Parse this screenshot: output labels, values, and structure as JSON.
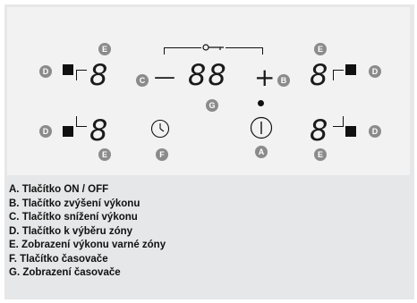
{
  "labels": {
    "A": "A",
    "B": "B",
    "C": "C",
    "D": "D",
    "E": "E",
    "F": "F",
    "G": "G"
  },
  "zone_display": "8",
  "timer_display": "88",
  "minus_symbol": "—",
  "plus_symbol": "+",
  "legend": [
    "A. Tlačítko ON / OFF",
    "B. Tlačítko zvýšení výkonu",
    "C. Tlačítko snížení výkonu",
    "D. Tlačítko k výběru zóny",
    "E. Zobrazení výkonu varné zóny",
    "F. Tlačítko časovače",
    "G. Zobrazení časovače"
  ],
  "colors": {
    "panel": "#f2f2f2",
    "frame": "#e6e7e8",
    "callout": "#8b8b8b"
  },
  "icons": [
    "lock-key-icon",
    "clock-icon",
    "power-icon"
  ]
}
